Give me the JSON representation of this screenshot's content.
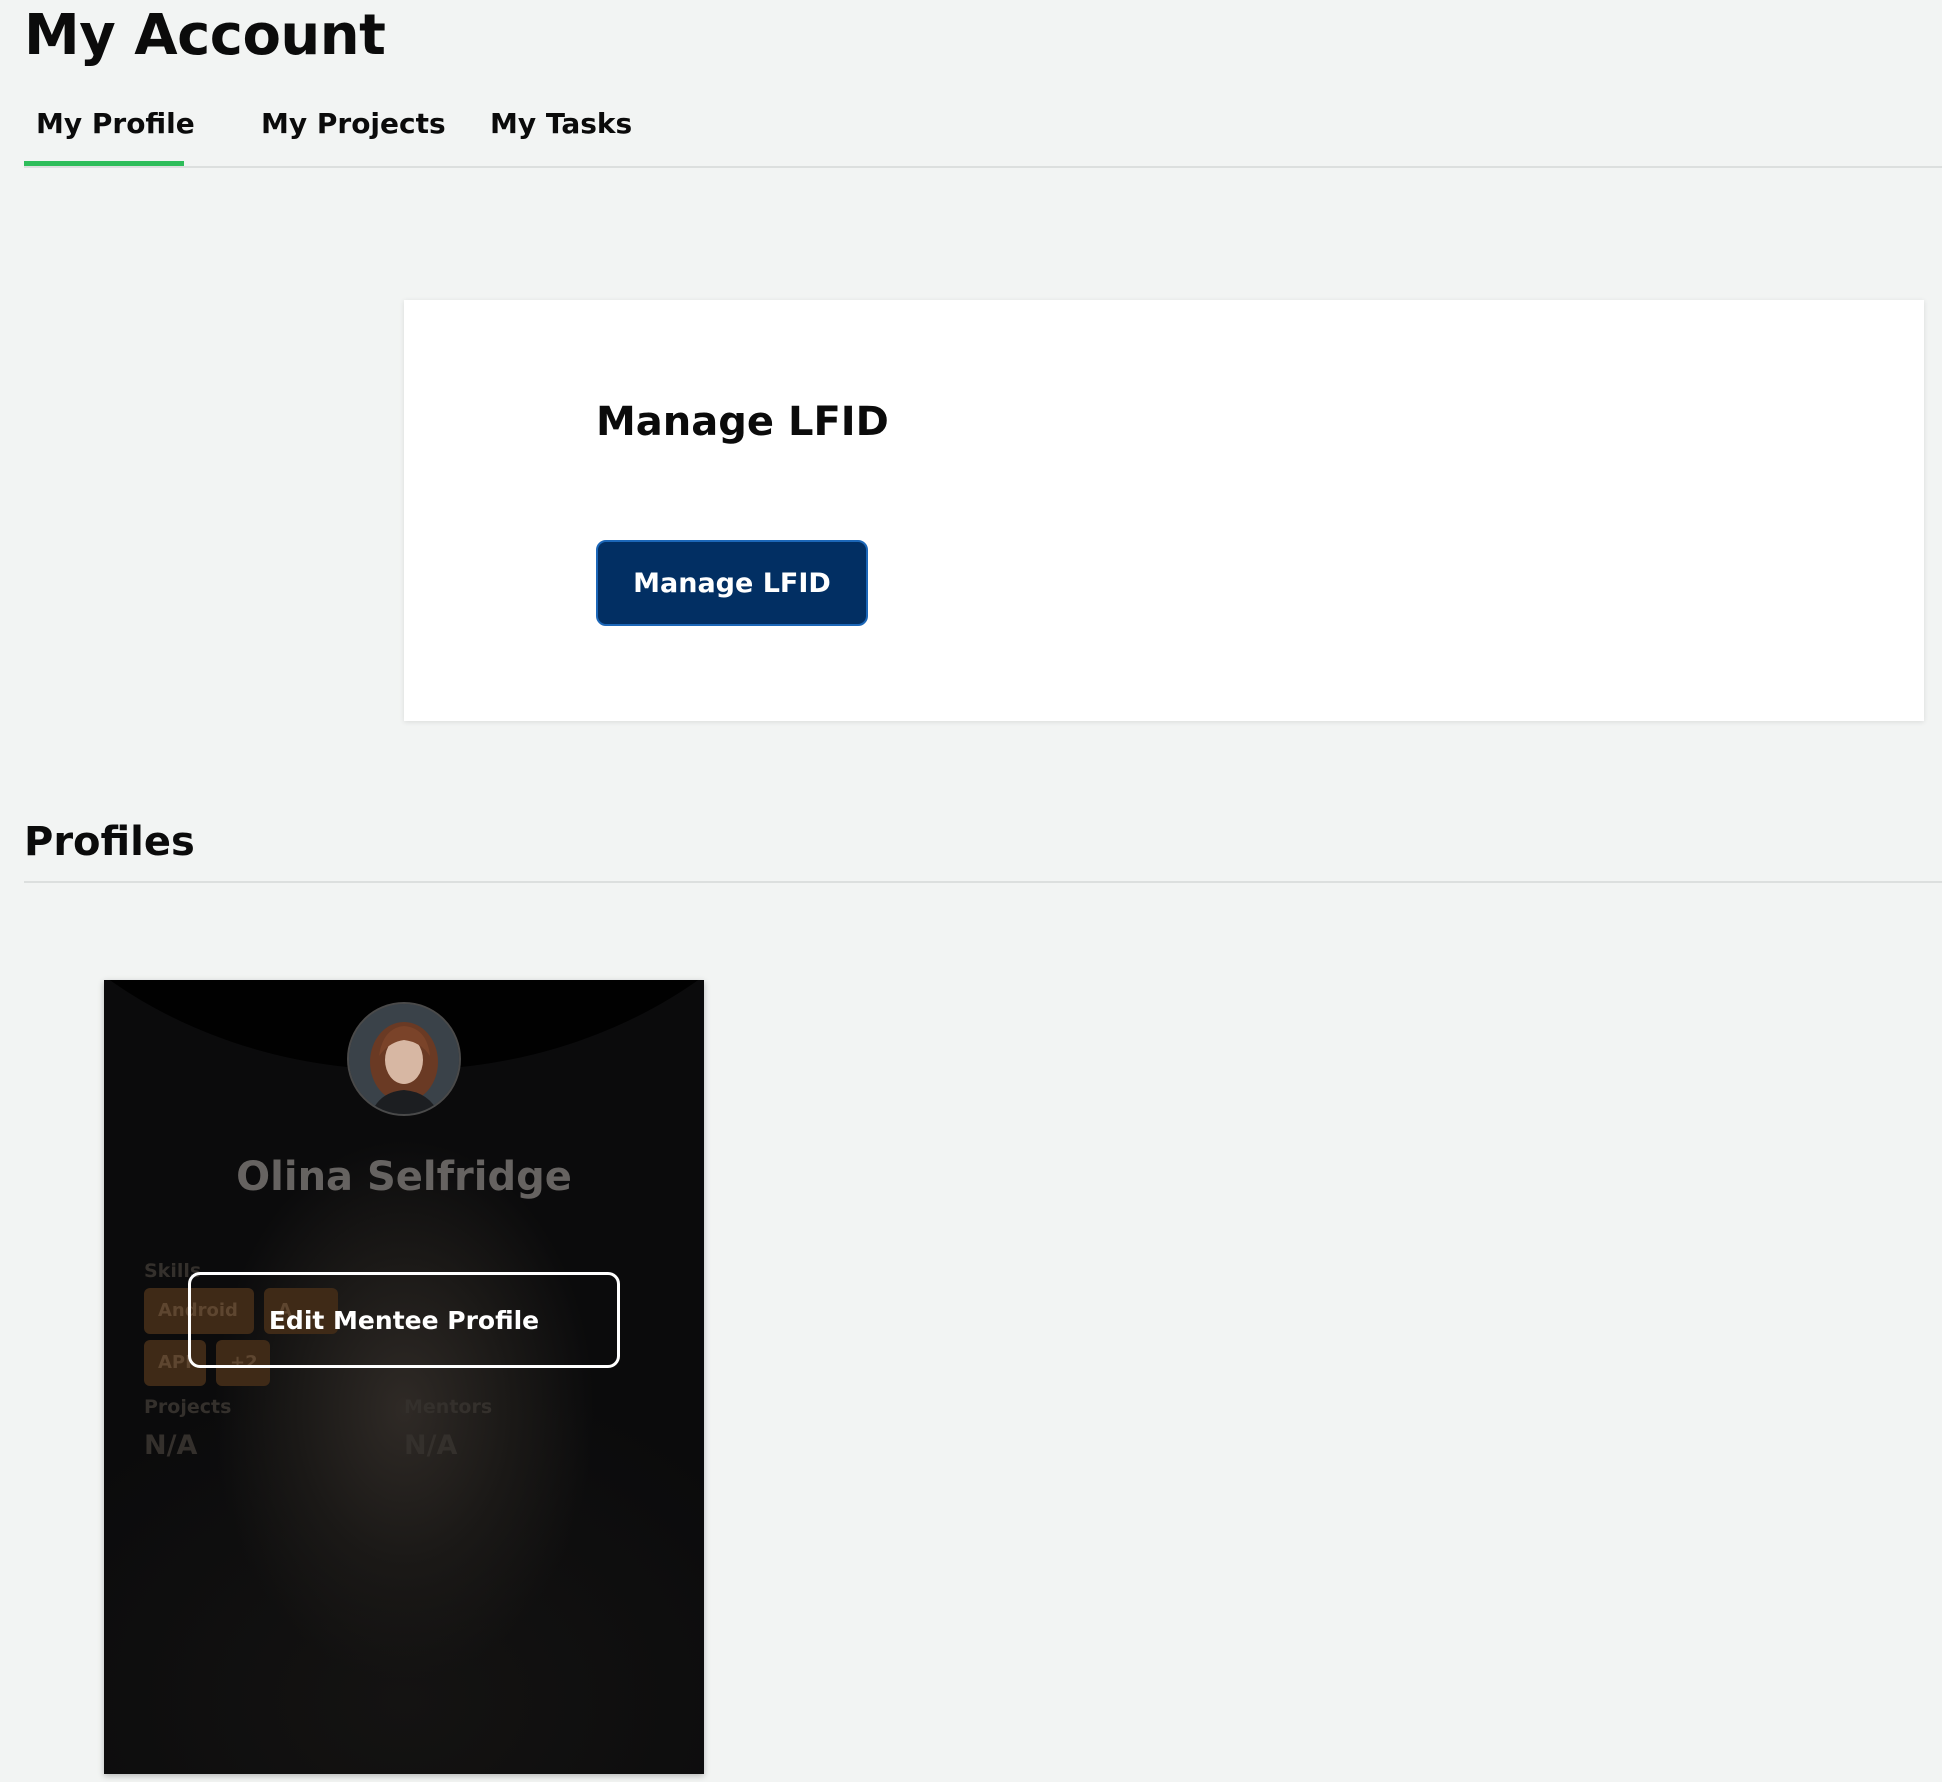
{
  "header": {
    "title": "My Account"
  },
  "tabs": [
    {
      "label": "My Profile",
      "active": true
    },
    {
      "label": "My Projects",
      "active": false
    },
    {
      "label": "My Tasks",
      "active": false
    }
  ],
  "lfid": {
    "title": "Manage LFID",
    "button_label": "Manage LFID"
  },
  "profiles": {
    "title": "Profiles",
    "cards": [
      {
        "name": "Olina Selfridge",
        "skills_label": "Skills",
        "skills": [
          "Android",
          "A",
          "API",
          "+2"
        ],
        "projects_label": "Projects",
        "projects_value": "N/A",
        "mentors_label": "Mentors",
        "mentors_value": "N/A",
        "edit_label": "Edit Mentee Profile"
      }
    ]
  },
  "colors": {
    "accent": "#2ebd5a",
    "primary_button": "#022f63",
    "primary_button_border": "#1c67b8",
    "background": "#f2f4f3"
  }
}
